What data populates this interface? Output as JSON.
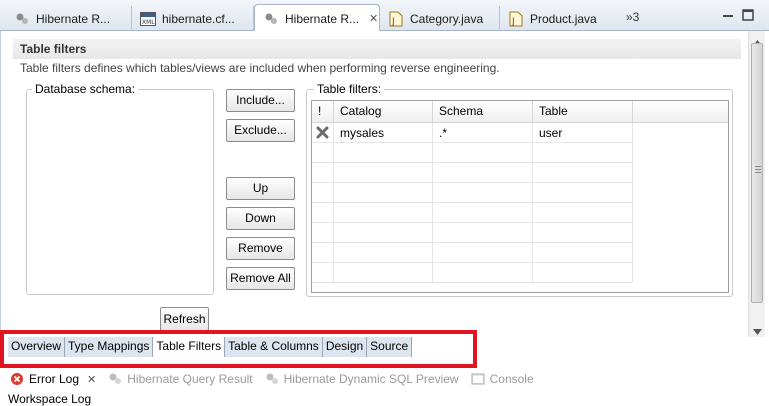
{
  "editor_tabs": [
    {
      "label": "Hibernate R...",
      "icon": "hibernate-icon"
    },
    {
      "label": "hibernate.cf...",
      "icon": "xml-file-icon"
    },
    {
      "label": "Hibernate R...",
      "icon": "hibernate-icon",
      "active": true
    },
    {
      "label": "Category.java",
      "icon": "java-file-icon"
    },
    {
      "label": "Product.java",
      "icon": "java-file-icon"
    }
  ],
  "overflow_label": "»3",
  "section": {
    "title": "Table filters",
    "description": "Table filters defines which tables/views are included when performing reverse engineering."
  },
  "db_schema": {
    "label": "Database schema:"
  },
  "buttons": {
    "include": "Include...",
    "exclude": "Exclude...",
    "up": "Up",
    "down": "Down",
    "remove": "Remove",
    "remove_all": "Remove All",
    "refresh": "Refresh"
  },
  "table_filters": {
    "label": "Table filters:",
    "columns": [
      "!",
      "Catalog",
      "Schema",
      "Table"
    ],
    "rows": [
      {
        "flag_icon": "exclude-x-icon",
        "catalog": "mysales",
        "schema": ".*",
        "table": "user"
      }
    ]
  },
  "bottom_tabs": [
    {
      "label": "Overview"
    },
    {
      "label": "Type Mappings"
    },
    {
      "label": "Table Filters",
      "active": true
    },
    {
      "label": "Table & Columns"
    },
    {
      "label": "Design"
    },
    {
      "label": "Source"
    }
  ],
  "views": [
    {
      "label": "Error Log",
      "icon": "error-log-icon",
      "active": true
    },
    {
      "label": "Hibernate Query Result",
      "icon": "hibernate-icon"
    },
    {
      "label": "Hibernate Dynamic SQL Preview",
      "icon": "hibernate-icon"
    },
    {
      "label": "Console",
      "icon": "console-icon"
    }
  ],
  "workspace_log": "Workspace Log",
  "colors": {
    "highlight": "#e0151f",
    "accent": "#a8b6c8"
  }
}
